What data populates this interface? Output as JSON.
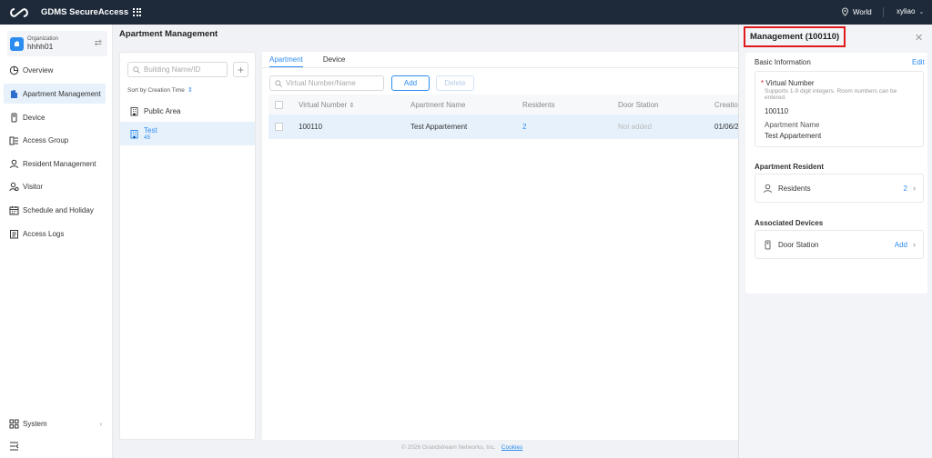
{
  "topbar": {
    "app_name": "GDMS SecureAccess",
    "region": "World",
    "user": "xyliao"
  },
  "sidebar": {
    "org_label": "Organization",
    "org_name": "hhhh01",
    "items": [
      {
        "label": "Overview",
        "icon": "pie-chart-icon"
      },
      {
        "label": "Apartment Management",
        "icon": "building-icon"
      },
      {
        "label": "Device",
        "icon": "device-icon"
      },
      {
        "label": "Access Group",
        "icon": "access-group-icon"
      },
      {
        "label": "Resident Management",
        "icon": "resident-icon"
      },
      {
        "label": "Visitor",
        "icon": "visitor-icon"
      },
      {
        "label": "Schedule and Holiday",
        "icon": "calendar-icon"
      },
      {
        "label": "Access Logs",
        "icon": "log-icon"
      }
    ],
    "system_label": "System"
  },
  "page": {
    "title": "Apartment Management"
  },
  "tree": {
    "search_placeholder": "Building Name/ID",
    "sort_label": "Sort by Creation Time",
    "nodes": [
      {
        "label": "Public Area",
        "count": ""
      },
      {
        "label": "Test",
        "count": "45"
      }
    ]
  },
  "content": {
    "tabs": [
      "Apartment",
      "Device"
    ],
    "search_placeholder": "Virtual Number/Name",
    "add_label": "Add",
    "delete_label": "Delete",
    "columns": [
      "Virtual Number",
      "Apartment Name",
      "Residents",
      "Door Station",
      "Creation"
    ],
    "rows": [
      {
        "virtual_number": "100110",
        "apartment_name": "Test Appartement",
        "residents": "2",
        "door_station": "Not added",
        "creation": "01/06/2"
      }
    ]
  },
  "panel": {
    "title": "Management (100110)",
    "basic_info_title": "Basic Information",
    "edit_label": "Edit",
    "virtual_number_label": "Virtual Number",
    "virtual_number_hint": "Supports 1-9 digit integers. Room numbers can be entered.",
    "virtual_number_value": "100110",
    "apartment_name_label": "Apartment Name",
    "apartment_name_value": "Test Appartement",
    "resident_section_title": "Apartment Resident",
    "residents_label": "Residents",
    "residents_count": "2",
    "devices_section_title": "Associated Devices",
    "door_station_label": "Door Station",
    "door_station_action": "Add"
  },
  "footer": {
    "copyright": "© 2026 Grandstream Networks, Inc.",
    "cookies": "Cookies"
  },
  "colors": {
    "accent": "#2d8cf0",
    "topbar": "#1e2a3a",
    "highlight": "#e0191d"
  }
}
